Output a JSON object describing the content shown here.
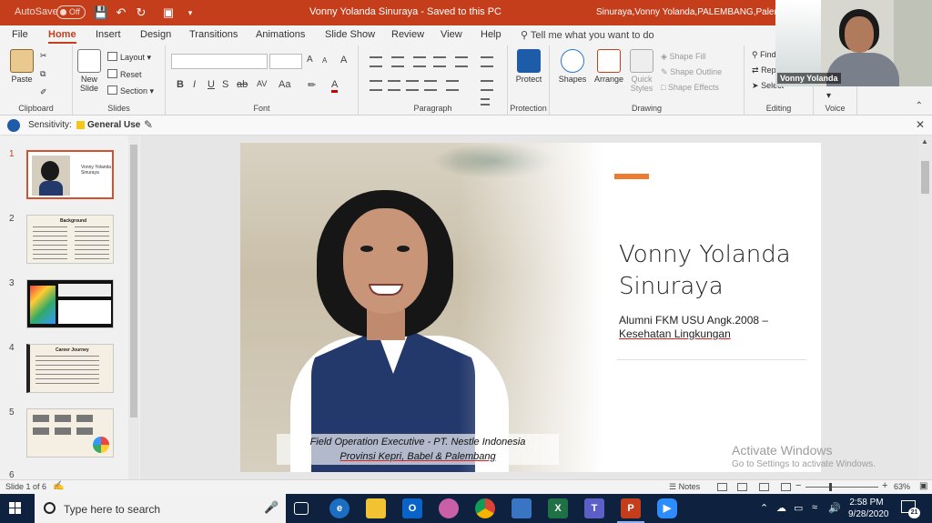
{
  "titlebar": {
    "autosave_label": "AutoSave",
    "autosave_state": "Off",
    "document_title": "Vonny Yolanda Sinuraya  -  Saved to this PC",
    "user_text": "Sinuraya,Vonny Yolanda,PALEMBANG,Palembang"
  },
  "tabs": [
    "File",
    "Home",
    "Insert",
    "Design",
    "Transitions",
    "Animations",
    "Slide Show",
    "Review",
    "View",
    "Help"
  ],
  "tell_me": "Tell me what you want to do",
  "ribbon": {
    "clipboard": {
      "paste": "Paste",
      "label": "Clipboard"
    },
    "slides": {
      "new_slide_l1": "New",
      "new_slide_l2": "Slide",
      "layout": "Layout",
      "reset": "Reset",
      "section": "Section",
      "label": "Slides"
    },
    "font": {
      "label": "Font",
      "bold": "B",
      "italic": "I",
      "underline": "U",
      "shadow": "S",
      "strike": "ab",
      "spacing": "AV",
      "case": "Aa",
      "grow": "A",
      "shrink": "A",
      "clear": "A"
    },
    "paragraph": {
      "label": "Paragraph"
    },
    "protection": {
      "protect": "Protect",
      "label": "Protection"
    },
    "drawing": {
      "shapes": "Shapes",
      "arrange": "Arrange",
      "quick_styles_l1": "Quick",
      "quick_styles_l2": "Styles",
      "shape_fill": "Shape Fill",
      "shape_outline": "Shape Outline",
      "shape_effects": "Shape Effects",
      "label": "Drawing"
    },
    "editing": {
      "find": "Find",
      "replace": "Replace",
      "select": "Select",
      "label": "Editing"
    },
    "voice": {
      "label": "Voice"
    }
  },
  "sensitivity": {
    "label": "Sensitivity:",
    "value": "General Use"
  },
  "thumbnails": {
    "numbers": [
      "1",
      "2",
      "3",
      "4",
      "5",
      "6"
    ],
    "slide1_title": "Vonny Yolanda Sinuraya",
    "slide2_title": "Background",
    "slide4_title": "Career Journey"
  },
  "slide": {
    "name_line1": "Vonny Yolanda",
    "name_line2": "Sinuraya",
    "subtitle_line1": "Alumni FKM USU Angk.2008 –",
    "subtitle_line2": "Kesehatan Lingkungan",
    "caption_line1": "Field Operation Executive - PT. Nestle Indonesia",
    "caption_line2": "Provinsi Kepri, Babel & Palembang"
  },
  "watermark": {
    "line1": "Activate Windows",
    "line2": "Go to Settings to activate Windows."
  },
  "webcam": {
    "name": "Vonny Yolanda"
  },
  "status": {
    "slide_info": "Slide 1 of 6",
    "notes": "Notes",
    "zoom_value": 63,
    "zoom": "63%"
  },
  "taskbar": {
    "search_placeholder": "Type here to search",
    "time": "2:58 PM",
    "date": "9/28/2020",
    "notification_count": "21",
    "apps": [
      "task-view",
      "edge",
      "file-explorer",
      "outlook",
      "paint",
      "chrome",
      "dictation",
      "excel",
      "teams",
      "powerpoint",
      "zoom"
    ]
  },
  "colors": {
    "accent": "#c43e1c",
    "title_accent": "#ec7c30",
    "taskbar": "#0e2240"
  }
}
